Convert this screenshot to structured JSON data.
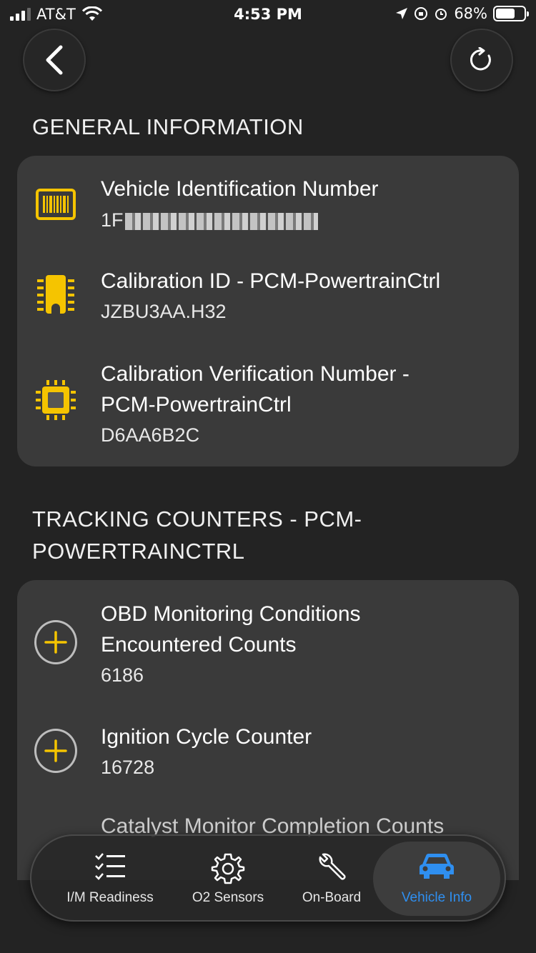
{
  "status_bar": {
    "carrier": "AT&T",
    "time": "4:53 PM",
    "battery": "68%"
  },
  "sections": {
    "general": "GENERAL INFORMATION",
    "tracking_line1": "TRACKING COUNTERS - PCM-",
    "tracking_line2": "POWERTRAINCTRL"
  },
  "general_items": [
    {
      "title": "Vehicle Identification Number",
      "value": "1F",
      "icon": "barcode-icon"
    },
    {
      "title": "Calibration ID - PCM-PowertrainCtrl",
      "value": "JZBU3AA.H32",
      "icon": "ecu-chip-icon"
    },
    {
      "title_line1": "Calibration Verification Number -",
      "title_line2": "PCM-PowertrainCtrl",
      "value": "D6AA6B2C",
      "icon": "processor-icon"
    }
  ],
  "tracking_items": [
    {
      "title_line1": "OBD Monitoring Conditions",
      "title_line2": "Encountered Counts",
      "value": "6186",
      "icon": "plus-circle-icon"
    },
    {
      "title": "Ignition Cycle Counter",
      "value": "16728",
      "icon": "plus-circle-icon"
    },
    {
      "title": "Catalyst Monitor Completion Counts"
    }
  ],
  "tabs": [
    {
      "label": "I/M Readiness",
      "icon": "checklist-icon"
    },
    {
      "label": "O2 Sensors",
      "icon": "gear-icon"
    },
    {
      "label": "On-Board",
      "icon": "wrench-icon"
    },
    {
      "label": "Vehicle Info",
      "icon": "car-icon"
    }
  ],
  "colors": {
    "accent_yellow": "#f5c400",
    "active_tab": "#2f8ff0",
    "card_bg": "#3a3a3a",
    "page_bg": "#232323"
  }
}
